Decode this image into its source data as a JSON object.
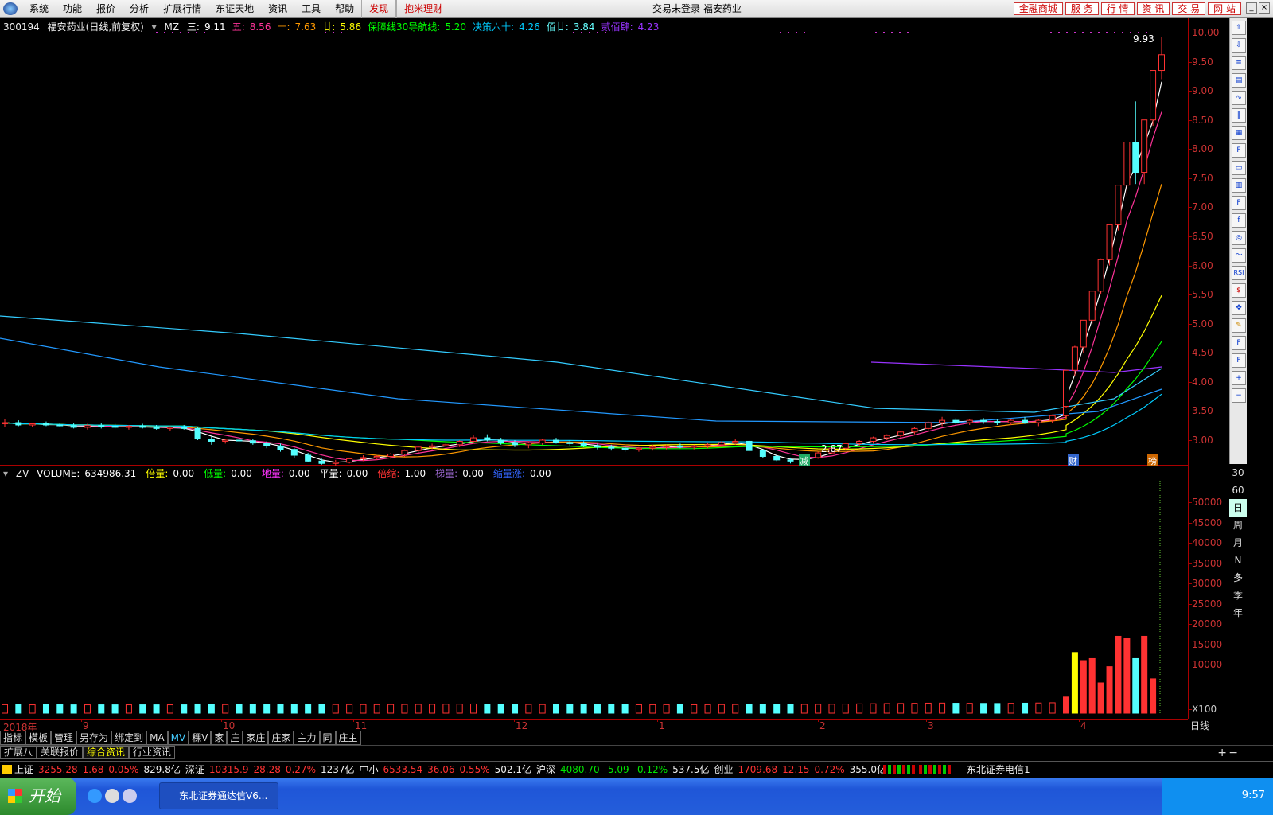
{
  "menubar": {
    "items": [
      "系统",
      "功能",
      "报价",
      "分析",
      "扩展行情",
      "东证天地",
      "资讯",
      "工具",
      "帮助"
    ],
    "red_items": [
      "发现",
      "抱米理财"
    ],
    "center_text": "交易未登录  福安药业",
    "right_buttons": [
      "金融商城",
      "服 务",
      "行 情",
      "资 讯",
      "交 易",
      "网 站"
    ]
  },
  "main_legend": {
    "code": "300194",
    "name": "福安药业(日线,前复权)",
    "indicator": "MZ",
    "items": [
      {
        "label": "三:",
        "value": "9.11",
        "color": "#ffffff"
      },
      {
        "label": "五:",
        "value": "8.56",
        "color": "#ff3399"
      },
      {
        "label": "十:",
        "value": "7.63",
        "color": "#ff9900"
      },
      {
        "label": "廿:",
        "value": "5.86",
        "color": "#ffff00"
      },
      {
        "label": "保障线30导航线:",
        "value": "5.20",
        "color": "#00ff00"
      },
      {
        "label": "决策六十:",
        "value": "4.26",
        "color": "#00ccff"
      },
      {
        "label": "佰廿:",
        "value": "3.84",
        "color": "#66ffff"
      },
      {
        "label": "贰佰肆:",
        "value": "4.23",
        "color": "#9933ff"
      }
    ]
  },
  "vol_legend": {
    "indicator": "ZV",
    "items": [
      {
        "label": "VOLUME:",
        "value": "634986.31",
        "color": "#ffffff"
      },
      {
        "label": "倍量:",
        "value": "0.00",
        "color": "#ffff00"
      },
      {
        "label": "低量:",
        "value": "0.00",
        "color": "#00ff00"
      },
      {
        "label": "地量:",
        "value": "0.00",
        "color": "#ff33ff"
      },
      {
        "label": "平量:",
        "value": "0.00",
        "color": "#ffffff"
      },
      {
        "label": "倍缩:",
        "value": "1.00",
        "color": "#ff3333"
      },
      {
        "label": "梯量:",
        "value": "0.00",
        "color": "#9966cc"
      },
      {
        "label": "缩量涨:",
        "value": "0.00",
        "color": "#3366ff"
      }
    ]
  },
  "price_axis": [
    "10.00",
    "9.50",
    "9.00",
    "8.50",
    "8.00",
    "7.50",
    "7.00",
    "6.50",
    "6.00",
    "5.50",
    "5.00",
    "4.50",
    "4.00",
    "3.50",
    "3.00"
  ],
  "vol_axis": [
    "50000",
    "45000",
    "40000",
    "35000",
    "30000",
    "25000",
    "20000",
    "15000",
    "10000"
  ],
  "vol_unit": "X100",
  "annotations": {
    "high": "9.93",
    "low": "2.87",
    "mark_1": "减",
    "mark_2": "财",
    "mark_3": "榜"
  },
  "date_axis": [
    "2018年",
    "9",
    "10",
    "11",
    "12",
    "1",
    "2",
    "3",
    "4"
  ],
  "period_label": "日线",
  "periods": [
    "30",
    "60",
    "日",
    "周",
    "月",
    "N",
    "多",
    "季",
    "年"
  ],
  "tabs_row1": [
    "指标",
    "模板",
    "管理",
    "另存为",
    "绑定到",
    "MA",
    "MV",
    "稞V",
    "家",
    "庄",
    "家庄",
    "庄家",
    "主力",
    "同",
    "庄主"
  ],
  "tabs_row2": [
    "扩展八",
    "关联报价",
    "综合资讯",
    "行业资讯"
  ],
  "status": {
    "sh_label": "上证",
    "sh_val": "3255.28",
    "sh_chg": "1.68",
    "sh_pct": "0.05%",
    "sh_amt": "829.8亿",
    "sz_label": "深证",
    "sz_val": "10315.9",
    "sz_chg": "28.28",
    "sz_pct": "0.27%",
    "sz_amt": "1237亿",
    "zx_label": "中小",
    "zx_val": "6533.54",
    "zx_chg": "36.06",
    "zx_pct": "0.55%",
    "zx_amt": "502.1亿",
    "hs_label": "沪深",
    "hs_val": "4080.70",
    "hs_chg": "-5.09",
    "hs_pct": "-0.12%",
    "hs_amt": "537.5亿",
    "cy_label": "创业",
    "cy_val": "1709.68",
    "cy_chg": "12.15",
    "cy_pct": "0.72%",
    "cy_amt": "355.0亿",
    "broker": "东北证券电信1"
  },
  "taskbar": {
    "start": "开始",
    "task": "东北证券通达信V6...",
    "clock": "9:57"
  },
  "colors": {
    "up": "#ff3232",
    "down": "#54ffff",
    "axis": "#aa0000"
  },
  "chart_data": {
    "type": "candlestick",
    "title": "300194 福安药业(日线,前复权)",
    "ylim": [
      2.8,
      10.1
    ],
    "candles": [
      [
        3.28,
        3.36,
        3.22,
        3.3
      ],
      [
        3.3,
        3.34,
        3.24,
        3.26
      ],
      [
        3.26,
        3.3,
        3.22,
        3.28
      ],
      [
        3.28,
        3.32,
        3.24,
        3.26
      ],
      [
        3.26,
        3.3,
        3.22,
        3.25
      ],
      [
        3.25,
        3.29,
        3.2,
        3.22
      ],
      [
        3.22,
        3.28,
        3.18,
        3.25
      ],
      [
        3.25,
        3.3,
        3.2,
        3.24
      ],
      [
        3.24,
        3.28,
        3.2,
        3.22
      ],
      [
        3.22,
        3.26,
        3.18,
        3.24
      ],
      [
        3.24,
        3.28,
        3.2,
        3.22
      ],
      [
        3.22,
        3.26,
        3.18,
        3.2
      ],
      [
        3.2,
        3.24,
        3.16,
        3.22
      ],
      [
        3.22,
        3.26,
        3.18,
        3.2
      ],
      [
        3.2,
        3.22,
        3.0,
        3.02
      ],
      [
        3.02,
        3.06,
        2.92,
        2.98
      ],
      [
        2.98,
        3.02,
        2.94,
        3.0
      ],
      [
        3.0,
        3.04,
        2.96,
        2.99
      ],
      [
        2.99,
        3.02,
        2.92,
        2.95
      ],
      [
        2.95,
        2.98,
        2.86,
        2.9
      ],
      [
        2.9,
        2.94,
        2.8,
        2.84
      ],
      [
        2.84,
        2.86,
        2.7,
        2.74
      ],
      [
        2.74,
        2.78,
        2.62,
        2.64
      ],
      [
        2.64,
        2.68,
        2.58,
        2.6
      ],
      [
        2.6,
        2.66,
        2.56,
        2.62
      ],
      [
        2.62,
        2.7,
        2.6,
        2.68
      ],
      [
        2.68,
        2.74,
        2.64,
        2.7
      ],
      [
        2.7,
        2.74,
        2.66,
        2.72
      ],
      [
        2.72,
        2.78,
        2.68,
        2.76
      ],
      [
        2.76,
        2.84,
        2.72,
        2.82
      ],
      [
        2.82,
        2.9,
        2.78,
        2.88
      ],
      [
        2.88,
        2.94,
        2.84,
        2.9
      ],
      [
        2.9,
        2.96,
        2.86,
        2.92
      ],
      [
        2.92,
        3.0,
        2.88,
        2.98
      ],
      [
        2.98,
        3.08,
        2.94,
        3.04
      ],
      [
        3.04,
        3.1,
        2.98,
        3.0
      ],
      [
        3.0,
        3.04,
        2.92,
        2.96
      ],
      [
        2.96,
        3.0,
        2.88,
        2.92
      ],
      [
        2.92,
        2.98,
        2.86,
        2.95
      ],
      [
        2.95,
        3.02,
        2.92,
        3.0
      ],
      [
        3.0,
        3.04,
        2.94,
        2.96
      ],
      [
        2.96,
        3.0,
        2.9,
        2.94
      ],
      [
        2.94,
        2.98,
        2.88,
        2.9
      ],
      [
        2.9,
        2.94,
        2.84,
        2.88
      ],
      [
        2.88,
        2.92,
        2.82,
        2.86
      ],
      [
        2.86,
        2.9,
        2.8,
        2.84
      ],
      [
        2.84,
        2.88,
        2.8,
        2.86
      ],
      [
        2.86,
        2.92,
        2.82,
        2.88
      ],
      [
        2.88,
        2.92,
        2.84,
        2.9
      ],
      [
        2.9,
        2.94,
        2.86,
        2.88
      ],
      [
        2.88,
        2.92,
        2.84,
        2.9
      ],
      [
        2.9,
        2.96,
        2.86,
        2.92
      ],
      [
        2.92,
        2.98,
        2.88,
        2.96
      ],
      [
        2.96,
        3.02,
        2.92,
        2.98
      ],
      [
        2.98,
        3.0,
        2.8,
        2.82
      ],
      [
        2.82,
        2.84,
        2.7,
        2.72
      ],
      [
        2.72,
        2.76,
        2.64,
        2.66
      ],
      [
        2.66,
        2.7,
        2.6,
        2.64
      ],
      [
        2.64,
        2.72,
        2.62,
        2.7
      ],
      [
        2.7,
        2.8,
        2.68,
        2.78
      ],
      [
        2.78,
        2.88,
        2.76,
        2.86
      ],
      [
        2.86,
        2.96,
        2.84,
        2.94
      ],
      [
        2.94,
        3.0,
        2.9,
        2.98
      ],
      [
        2.98,
        3.06,
        2.94,
        3.04
      ],
      [
        3.04,
        3.1,
        3.0,
        3.08
      ],
      [
        3.08,
        3.16,
        3.04,
        3.14
      ],
      [
        3.14,
        3.22,
        3.1,
        3.2
      ],
      [
        3.2,
        3.32,
        3.16,
        3.3
      ],
      [
        3.3,
        3.4,
        3.24,
        3.34
      ],
      [
        3.34,
        3.38,
        3.26,
        3.3
      ],
      [
        3.3,
        3.36,
        3.26,
        3.34
      ],
      [
        3.34,
        3.38,
        3.28,
        3.32
      ],
      [
        3.32,
        3.36,
        3.26,
        3.3
      ],
      [
        3.3,
        3.36,
        3.26,
        3.34
      ],
      [
        3.34,
        3.4,
        3.28,
        3.3
      ],
      [
        3.3,
        3.36,
        3.24,
        3.34
      ],
      [
        3.34,
        3.44,
        3.3,
        3.42
      ],
      [
        3.42,
        3.6,
        3.4,
        3.58
      ],
      [
        3.58,
        4.2,
        3.56,
        4.2
      ],
      [
        4.2,
        4.62,
        4.1,
        4.6
      ],
      [
        4.6,
        5.06,
        4.5,
        5.06
      ],
      [
        5.06,
        5.56,
        5.0,
        5.56
      ],
      [
        5.56,
        6.12,
        5.5,
        6.1
      ],
      [
        6.1,
        6.71,
        6.0,
        6.7
      ],
      [
        6.7,
        7.38,
        6.6,
        7.38
      ],
      [
        7.38,
        8.12,
        7.2,
        8.12
      ],
      [
        8.12,
        8.82,
        7.4,
        7.6
      ],
      [
        7.6,
        8.5,
        7.4,
        8.5
      ],
      [
        8.5,
        9.35,
        8.4,
        9.35
      ],
      [
        9.35,
        9.93,
        9.2,
        9.62
      ]
    ],
    "volume_scale_x100": true,
    "volumes": [
      120,
      110,
      90,
      100,
      95,
      80,
      90,
      85,
      80,
      90,
      85,
      80,
      90,
      85,
      300,
      200,
      150,
      140,
      160,
      180,
      220,
      260,
      200,
      180,
      170,
      160,
      150,
      140,
      160,
      180,
      200,
      220,
      240,
      260,
      300,
      280,
      240,
      200,
      180,
      160,
      150,
      140,
      130,
      120,
      110,
      100,
      110,
      120,
      130,
      120,
      110,
      130,
      150,
      170,
      200,
      240,
      260,
      220,
      200,
      210,
      240,
      280,
      320,
      360,
      400,
      420,
      460,
      500,
      520,
      480,
      460,
      440,
      420,
      460,
      500,
      540,
      600,
      1200,
      2000,
      13000,
      11000,
      11500,
      5500,
      9500,
      17000,
      16500,
      11500,
      17000,
      6500
    ]
  }
}
